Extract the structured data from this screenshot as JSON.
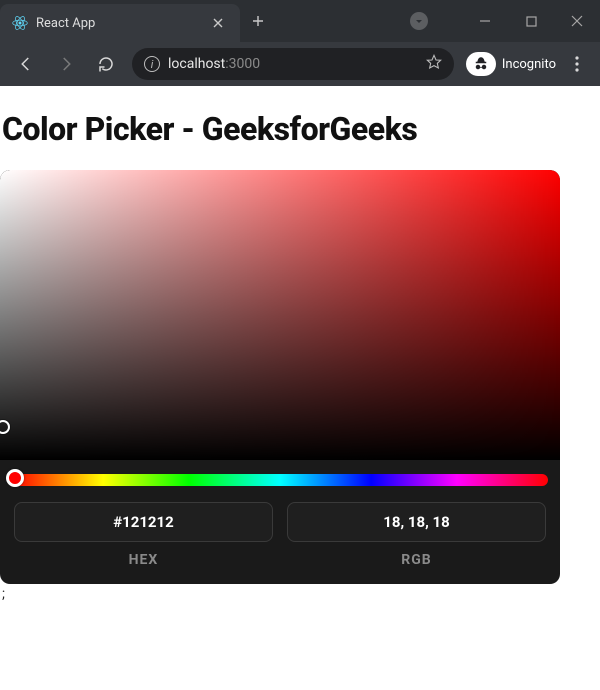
{
  "window": {
    "tab_title": "React App",
    "incognito_label": "Incognito"
  },
  "omnibox": {
    "host": "localhost",
    "port": ":3000"
  },
  "page": {
    "heading": "Color Picker - GeeksforGeeks",
    "stray": ";"
  },
  "picker": {
    "hue_hex": "#ff0000",
    "hex_value": "#121212",
    "rgb_value": "18, 18, 18",
    "hex_label": "HEX",
    "rgb_label": "RGB"
  }
}
